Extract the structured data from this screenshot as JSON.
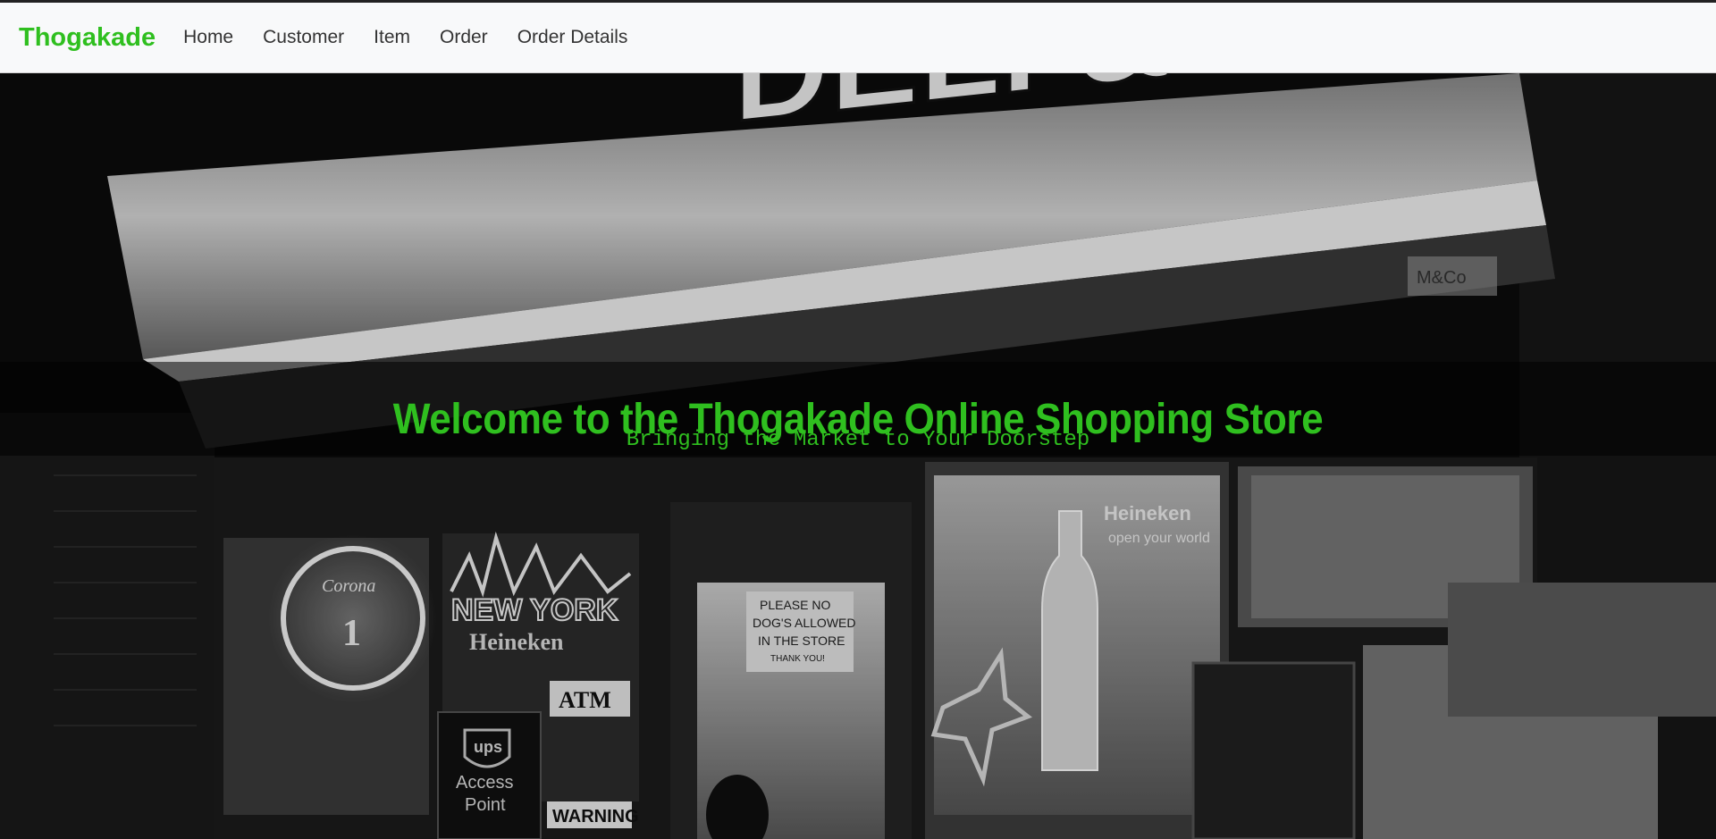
{
  "navbar": {
    "brand": "Thogakade",
    "links": [
      "Home",
      "Customer",
      "Item",
      "Order",
      "Order Details"
    ]
  },
  "hero": {
    "title": "Welcome to the Thogakade Online Shopping Store",
    "subtitle": "Bringing the Market to Your Doorstep",
    "photo": {
      "sign_text": "DELI & GROCERY",
      "sign_small": "M&Co",
      "neon_signs": [
        "Corona",
        "1",
        "NEW YORK",
        "Heineken"
      ],
      "atm": "ATM",
      "ups_lines": [
        "ups",
        "Access",
        "Point"
      ],
      "door_sign": [
        "PLEASE NO",
        "DOG'S ALLOWED",
        "IN THE STORE",
        "THANK YOU!"
      ],
      "heineken_window": [
        "Heineken",
        "open your world"
      ],
      "warning": "WARNING"
    }
  },
  "colors": {
    "accent_green": "#2fbf1f",
    "navbar_bg": "#f8f9fa",
    "nav_text": "#333333"
  }
}
